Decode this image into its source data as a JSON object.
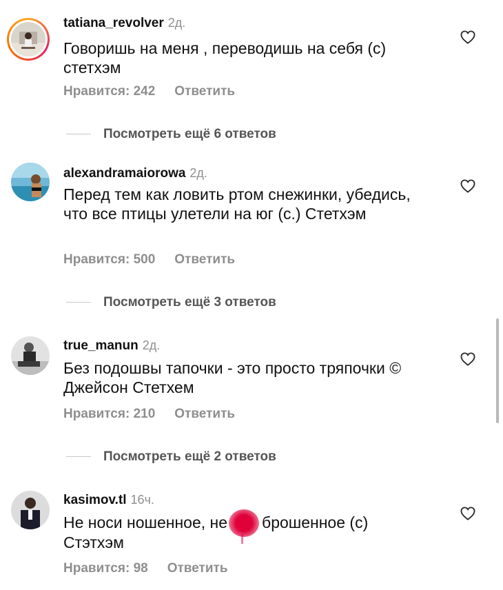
{
  "comments": [
    {
      "username": "tatiana_revolver",
      "time": "2д.",
      "text": "Говоришь на меня , переводишь на себя (с) стетхэм",
      "likes": "Нравится: 242",
      "reply": "Ответить",
      "more_replies": "Посмотреть ещё 6 ответов"
    },
    {
      "username": "alexandramaiorowa",
      "time": "2д.",
      "text": "Перед тем как ловить ртом снежинки, убедись, что все птицы улетели на юг (с.) Стетхэм",
      "likes": "Нравится: 500",
      "reply": "Ответить",
      "more_replies": "Посмотреть ещё 3 ответов"
    },
    {
      "username": "true_manun",
      "time": "2д.",
      "text": "Без подошвы тапочки - это просто тряпочки © Джейсон Стетхем",
      "likes": "Нравится: 210",
      "reply": "Ответить",
      "more_replies": "Посмотреть ещё 2 ответов"
    },
    {
      "username": "kasimov.tl",
      "time": "16ч.",
      "text_part1": "Не носи ношенное, не",
      "text_part2": "брошенное (с)",
      "text_part3": "Стэтхэм",
      "likes": "Нравится: 98",
      "reply": "Ответить"
    }
  ],
  "icons": {
    "like": "heart-outline-icon"
  },
  "colors": {
    "secondary_text": "#8e8e8e",
    "story_ring": "#e91e63",
    "redaction": "#e0003a"
  }
}
